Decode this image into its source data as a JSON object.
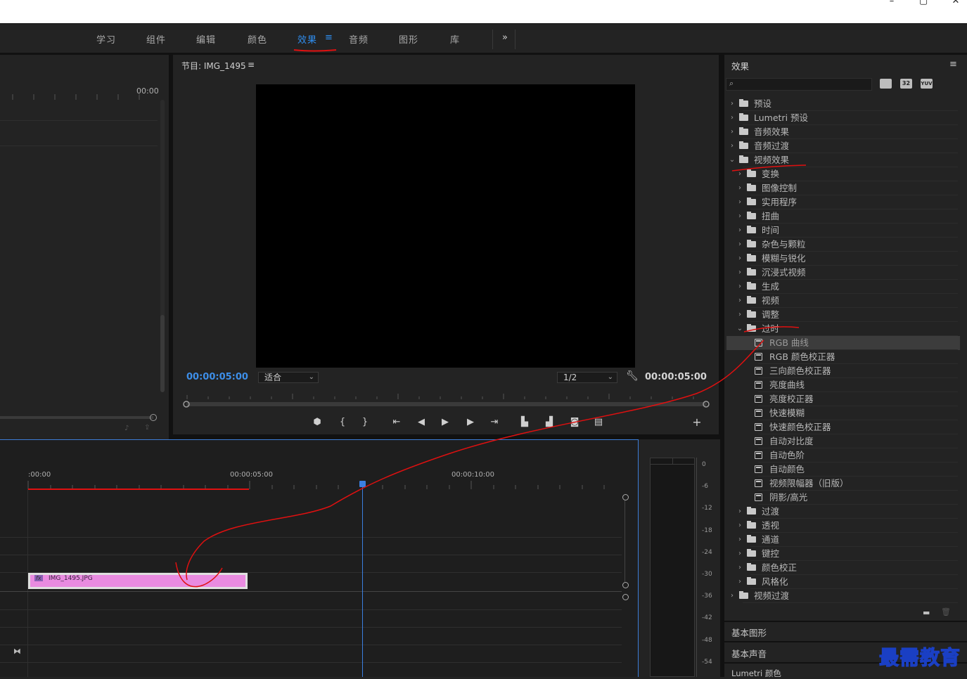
{
  "window": {
    "minimize": "–",
    "maximize": "▢",
    "close": "✕"
  },
  "workspaces": {
    "tabs": [
      "学习",
      "组件",
      "编辑",
      "颜色",
      "效果",
      "音频",
      "图形",
      "库"
    ],
    "active": "效果",
    "active_menu_glyph": "≡",
    "more": "»"
  },
  "source_panel": {
    "timecode": "00:00"
  },
  "program_monitor": {
    "title": "节目: IMG_1495",
    "menu_glyph": "≡",
    "current_time": "00:00:05:00",
    "fit_value": "适合",
    "resolution": "1/2",
    "duration": "00:00:05:00"
  },
  "effects_panel": {
    "title": "效果",
    "menu_glyph": "≡",
    "search_placeholder": "",
    "badges": [
      "32",
      "YUV"
    ],
    "tree": [
      {
        "label": "预设",
        "level": 0,
        "kind": "folder-star",
        "expanded": false
      },
      {
        "label": "Lumetri 预设",
        "level": 0,
        "kind": "folder-star",
        "expanded": false
      },
      {
        "label": "音频效果",
        "level": 0,
        "kind": "folder",
        "expanded": false
      },
      {
        "label": "音频过渡",
        "level": 0,
        "kind": "folder",
        "expanded": false
      },
      {
        "label": "视频效果",
        "level": 0,
        "kind": "folder",
        "expanded": true
      },
      {
        "label": "变换",
        "level": 1,
        "kind": "folder",
        "expanded": false
      },
      {
        "label": "图像控制",
        "level": 1,
        "kind": "folder",
        "expanded": false
      },
      {
        "label": "实用程序",
        "level": 1,
        "kind": "folder",
        "expanded": false
      },
      {
        "label": "扭曲",
        "level": 1,
        "kind": "folder",
        "expanded": false
      },
      {
        "label": "时间",
        "level": 1,
        "kind": "folder",
        "expanded": false
      },
      {
        "label": "杂色与颗粒",
        "level": 1,
        "kind": "folder",
        "expanded": false
      },
      {
        "label": "模糊与锐化",
        "level": 1,
        "kind": "folder",
        "expanded": false
      },
      {
        "label": "沉浸式视频",
        "level": 1,
        "kind": "folder",
        "expanded": false
      },
      {
        "label": "生成",
        "level": 1,
        "kind": "folder",
        "expanded": false
      },
      {
        "label": "视频",
        "level": 1,
        "kind": "folder",
        "expanded": false
      },
      {
        "label": "调整",
        "level": 1,
        "kind": "folder",
        "expanded": false
      },
      {
        "label": "过时",
        "level": 1,
        "kind": "folder",
        "expanded": true
      },
      {
        "label": "RGB 曲线",
        "level": 2,
        "kind": "effect",
        "selected": true
      },
      {
        "label": "RGB 颜色校正器",
        "level": 2,
        "kind": "effect"
      },
      {
        "label": "三向颜色校正器",
        "level": 2,
        "kind": "effect"
      },
      {
        "label": "亮度曲线",
        "level": 2,
        "kind": "effect"
      },
      {
        "label": "亮度校正器",
        "level": 2,
        "kind": "effect"
      },
      {
        "label": "快速模糊",
        "level": 2,
        "kind": "effect"
      },
      {
        "label": "快速颜色校正器",
        "level": 2,
        "kind": "effect"
      },
      {
        "label": "自动对比度",
        "level": 2,
        "kind": "effect"
      },
      {
        "label": "自动色阶",
        "level": 2,
        "kind": "effect"
      },
      {
        "label": "自动颜色",
        "level": 2,
        "kind": "effect"
      },
      {
        "label": "视频限幅器（旧版）",
        "level": 2,
        "kind": "effect"
      },
      {
        "label": "阴影/高光",
        "level": 2,
        "kind": "effect"
      },
      {
        "label": "过渡",
        "level": 1,
        "kind": "folder",
        "expanded": false
      },
      {
        "label": "透视",
        "level": 1,
        "kind": "folder",
        "expanded": false
      },
      {
        "label": "通道",
        "level": 1,
        "kind": "folder",
        "expanded": false
      },
      {
        "label": "键控",
        "level": 1,
        "kind": "folder",
        "expanded": false
      },
      {
        "label": "颜色校正",
        "level": 1,
        "kind": "folder",
        "expanded": false
      },
      {
        "label": "风格化",
        "level": 1,
        "kind": "folder",
        "expanded": false
      },
      {
        "label": "视频过渡",
        "level": 0,
        "kind": "folder",
        "expanded": false
      }
    ],
    "bottom_sections": [
      "基本图形",
      "基本声音",
      "Lumetri 颜色"
    ]
  },
  "timeline": {
    "ruler": [
      ":00:00",
      "00:00:05:00",
      "00:00:10:00"
    ],
    "clip_label": "IMG_1495.JPG",
    "clip_fx": "fx",
    "clip_color": "#e98be0",
    "playhead_color": "#3b7fe0"
  },
  "audio_meter": {
    "scale": [
      "0",
      "-6",
      "-12",
      "-18",
      "-24",
      "-30",
      "-36",
      "-42",
      "-48",
      "-54"
    ]
  },
  "watermark": "最需教育",
  "annotation_color": "#e01010"
}
